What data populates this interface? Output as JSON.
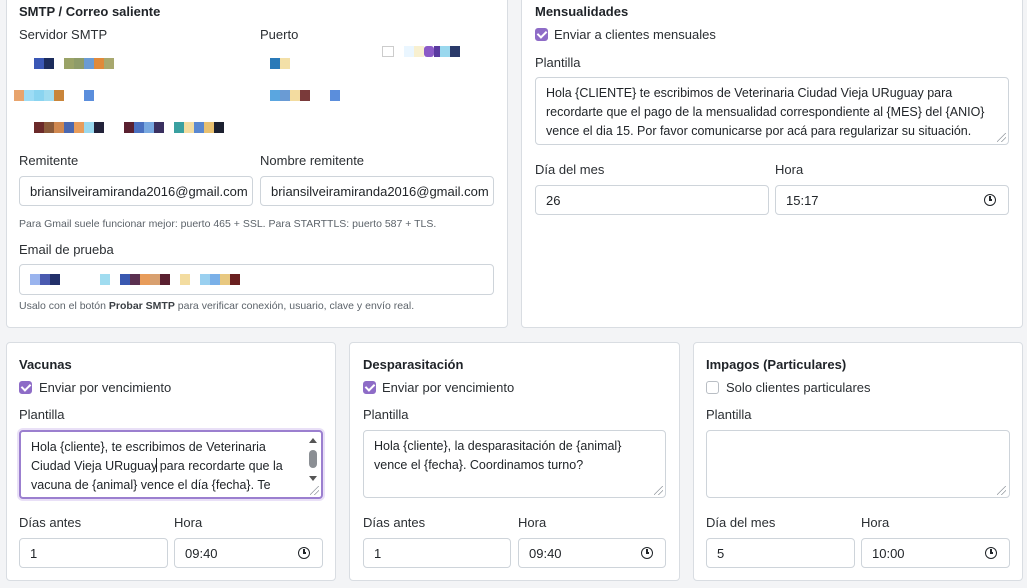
{
  "smtp": {
    "title": "SMTP / Correo saliente",
    "server_label": "Servidor SMTP",
    "port_label": "Puerto",
    "sender_label": "Remitente",
    "sender_value": "briansilveiramiranda2016@gmail.com",
    "sender_name_label": "Nombre remitente",
    "sender_name_value": "briansilveiramiranda2016@gmail.com",
    "gmail_hint": "Para Gmail suele funcionar mejor: puerto 465 + SSL. Para STARTTLS: puerto 587 + TLS.",
    "test_email_label": "Email de prueba",
    "test_hint_prefix": "Usalo con el botón ",
    "test_hint_button": "Probar SMTP",
    "test_hint_suffix": " para verificar conexión, usuario, clave y envío real."
  },
  "mensualidades": {
    "title": "Mensualidades",
    "send_label": "Enviar a clientes mensuales",
    "send_checked": true,
    "template_label": "Plantilla",
    "template_line1": "Hola {CLIENTE} te escribimos de Veterinaria Ciudad Vieja URuguay para",
    "template_line2": "recordarte que el pago de la mensualidad correspondiente al {MES}  del {ANIO}",
    "template_line3": "vence el dia 15. Por favor comunicarse por acá para regularizar su situación.",
    "day_label": "Día del mes",
    "day_value": "26",
    "hour_label": "Hora",
    "hour_value": "15:17"
  },
  "vacunas": {
    "title": "Vacunas",
    "send_label": "Enviar por vencimiento",
    "send_checked": true,
    "template_label": "Plantilla",
    "template_line1": "Hola {cliente}, te escribimos de  Veterinaria",
    "template_line2a": "Ciudad Vieja URuguay",
    "template_line2b": " para recordarte que la",
    "template_line3": "vacuna de {animal} vence el día {fecha}. Te",
    "days_label": "Días antes",
    "days_value": "1",
    "hour_label": "Hora",
    "hour_value": "09:40"
  },
  "desparasitacion": {
    "title": "Desparasitación",
    "send_label": "Enviar por vencimiento",
    "send_checked": true,
    "template_label": "Plantilla",
    "template_line1": "Hola {cliente}, la desparasitación de {animal}",
    "template_line2": "vence el {fecha}. Coordinamos turno?",
    "days_label": "Días antes",
    "days_value": "1",
    "hour_label": "Hora",
    "hour_value": "09:40"
  },
  "impagos": {
    "title": "Impagos (Particulares)",
    "send_label": "Solo clientes particulares",
    "send_checked": false,
    "template_label": "Plantilla",
    "template_value": "",
    "day_label": "Día del mes",
    "day_value": "5",
    "hour_label": "Hora",
    "hour_value": "10:00"
  },
  "icons": {
    "clock": "clock-icon",
    "checkbox": "checkbox-icon"
  },
  "colors": {
    "accent": "#8e6cc7",
    "focus_border": "#9b7fcf",
    "card_border": "#d9dde2",
    "page_bg": "#f3f4f6"
  }
}
